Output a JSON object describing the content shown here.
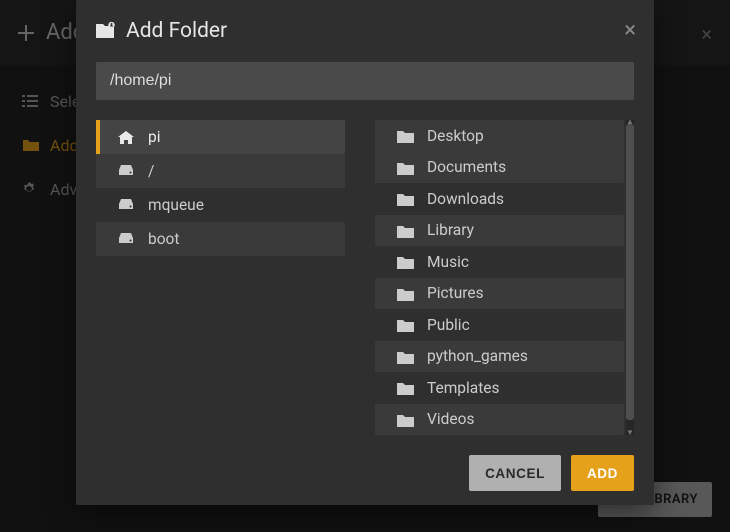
{
  "background": {
    "header": {
      "title": "Add Library"
    },
    "steps": [
      {
        "key": "select-type",
        "label": "Select type",
        "active": false
      },
      {
        "key": "add-folders",
        "label": "Add folders",
        "active": true
      },
      {
        "key": "advanced",
        "label": "Advanced",
        "active": false
      }
    ],
    "footer": {
      "add_library": "ADD LIBRARY"
    }
  },
  "modal": {
    "title": "Add Folder",
    "path": "/home/pi",
    "left": [
      {
        "key": "pi",
        "name": "pi",
        "icon": "home-icon",
        "active": true,
        "shaded": true
      },
      {
        "key": "root",
        "name": "/",
        "icon": "drive-icon",
        "active": false,
        "shaded": true
      },
      {
        "key": "mqueue",
        "name": "mqueue",
        "icon": "drive-icon",
        "active": false,
        "shaded": false
      },
      {
        "key": "boot",
        "name": "boot",
        "icon": "drive-icon",
        "active": false,
        "shaded": true
      }
    ],
    "right": [
      {
        "key": "desktop",
        "name": "Desktop",
        "shaded": true
      },
      {
        "key": "documents",
        "name": "Documents",
        "shaded": true
      },
      {
        "key": "downloads",
        "name": "Downloads",
        "shaded": false
      },
      {
        "key": "library",
        "name": "Library",
        "shaded": true
      },
      {
        "key": "music",
        "name": "Music",
        "shaded": false
      },
      {
        "key": "pictures",
        "name": "Pictures",
        "shaded": true
      },
      {
        "key": "public",
        "name": "Public",
        "shaded": false
      },
      {
        "key": "pythongames",
        "name": "python_games",
        "shaded": true
      },
      {
        "key": "templates",
        "name": "Templates",
        "shaded": false
      },
      {
        "key": "videos",
        "name": "Videos",
        "shaded": true
      }
    ],
    "buttons": {
      "cancel": "CANCEL",
      "add": "ADD"
    }
  },
  "colors": {
    "accent": "#e6a11a"
  }
}
